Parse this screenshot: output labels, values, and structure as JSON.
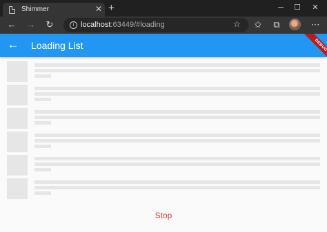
{
  "browser": {
    "tab_title": "Shimmer",
    "url_host": "localhost",
    "url_rest": ":63449/#loading",
    "icons": [
      "file-icon",
      "close-icon",
      "plus-icon",
      "back-icon",
      "forward-icon",
      "reload-icon",
      "info-icon",
      "favorite-star-icon",
      "collections-icon",
      "profile-avatar",
      "more-icon"
    ]
  },
  "app": {
    "title": "Loading List",
    "debug_banner": "DEBUG",
    "stop_label": "Stop",
    "appbar_color": "#2196f3",
    "stop_color": "#e53935",
    "skeleton_color": "#e6e6e6",
    "list_item_count": 6
  }
}
